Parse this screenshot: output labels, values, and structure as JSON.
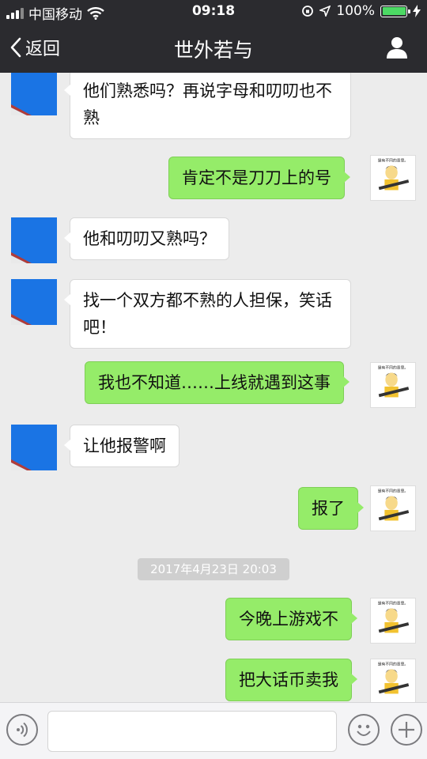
{
  "status_bar": {
    "carrier": "中国移动",
    "time": "09:18",
    "battery_percent": "100%"
  },
  "nav": {
    "back_label": "返回",
    "title": "世外若与"
  },
  "timestamp": "2017年4月23日 20:03",
  "messages": [
    {
      "side": "in",
      "text": "他们熟悉吗？再说字母和叨叨也不熟"
    },
    {
      "side": "out",
      "text": "肯定不是刀刀上的号"
    },
    {
      "side": "in",
      "text": "他和叨叨又熟吗？"
    },
    {
      "side": "in",
      "text": "找一个双方都不熟的人担保，笑话吧！"
    },
    {
      "side": "out",
      "text": "我也不知道……上线就遇到这事"
    },
    {
      "side": "in",
      "text": "让他报警啊"
    },
    {
      "side": "out",
      "text": "报了"
    },
    {
      "side": "out",
      "text": "今晚上游戏不"
    },
    {
      "side": "out",
      "text": "把大话币卖我"
    }
  ],
  "avatar_caption": "是有不同的意思。",
  "colors": {
    "navbar": "#2b2b2f",
    "out_bubble": "#95ec69",
    "in_bubble": "#ffffff",
    "chat_bg": "#ececec"
  },
  "icons": {
    "back": "chevron-left-icon",
    "profile": "person-icon",
    "voice": "voice-icon",
    "emoji": "emoji-icon",
    "plus": "plus-icon"
  }
}
